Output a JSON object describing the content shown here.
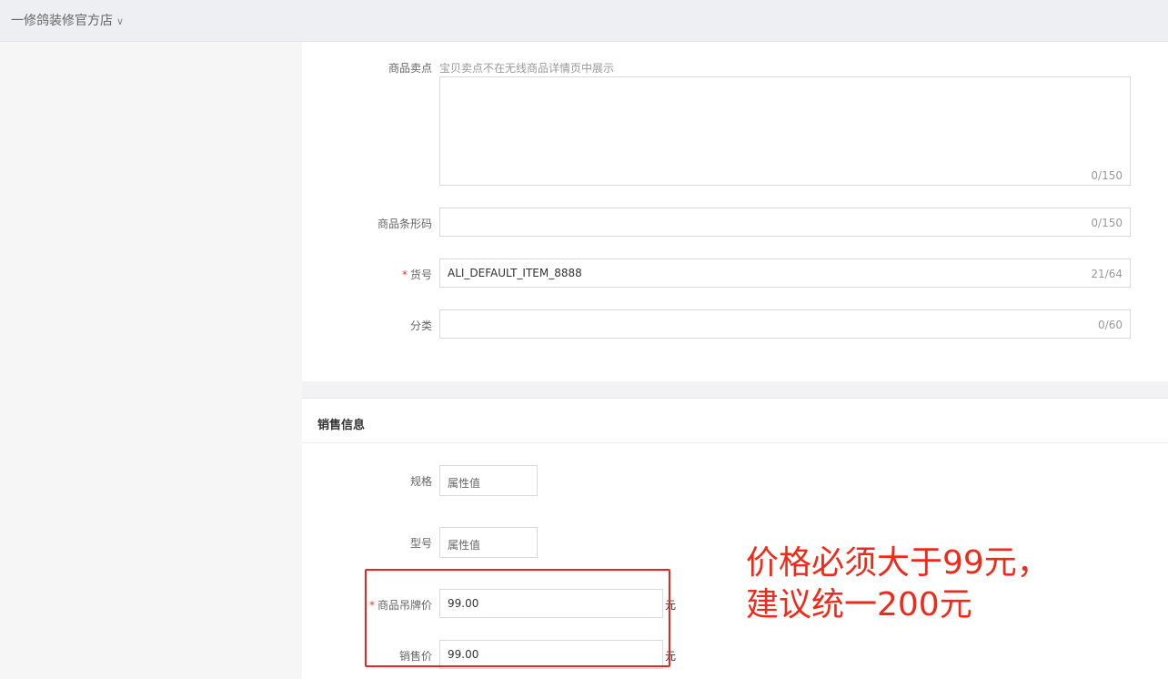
{
  "header": {
    "store_name": "一修鸽装修官方店",
    "chevron": "∨"
  },
  "basic_info": {
    "selling_point": {
      "label": "商品卖点",
      "hint": "宝贝卖点不在无线商品详情页中展示",
      "value": "",
      "counter": "0/150"
    },
    "barcode": {
      "label": "商品条形码",
      "value": "",
      "counter": "0/150"
    },
    "item_no": {
      "label": "货号",
      "required_mark": "*",
      "value": "ALI_DEFAULT_ITEM_8888",
      "counter": "21/64"
    },
    "category": {
      "label": "分类",
      "value": "",
      "counter": "0/60"
    }
  },
  "sales_info": {
    "title": "销售信息",
    "spec": {
      "label": "规格",
      "placeholder": "属性值"
    },
    "model": {
      "label": "型号",
      "placeholder": "属性值"
    },
    "tag_price": {
      "label": "商品吊牌价",
      "required_mark": "*",
      "value": "99.00",
      "unit": "元"
    },
    "sale_price": {
      "label": "销售价",
      "value": "99.00",
      "unit": "元"
    }
  },
  "annotation": {
    "line1": "价格必须大于99元，",
    "line2": "建议统一200元",
    "color": "#ee2b1a"
  }
}
